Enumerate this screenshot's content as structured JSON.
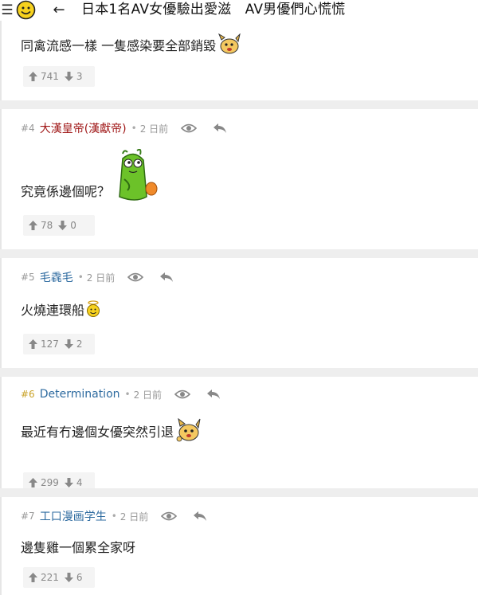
{
  "header": {
    "thread_title": "日本1名AV女優驗出愛滋　AV男優們心慌慌"
  },
  "posts": [
    {
      "content": "同禽流感一樣 一隻感染要全部銷毀",
      "emoji": "horned-dog-sticker",
      "upvotes": "741",
      "downvotes": "3"
    },
    {
      "floor": "#4",
      "author": "大漢皇帝(漢獻帝)",
      "time": "2 日前",
      "content": "究竟係邊個呢？",
      "emoji": "green-worm-sticker",
      "upvotes": "78",
      "downvotes": "0"
    },
    {
      "floor": "#5",
      "author": "毛毳毛",
      "time": "2 日前",
      "content": "火燒連環船",
      "emoji": "angel-smiley",
      "upvotes": "127",
      "downvotes": "2"
    },
    {
      "floor": "#6",
      "author": "Determination",
      "time": "2 日前",
      "content": "最近有冇邊個女優突然引退",
      "emoji": "dog-sticker",
      "upvotes": "299",
      "downvotes": "4"
    },
    {
      "floor": "#7",
      "author": "工口漫画学生",
      "time": "2 日前",
      "content": "邊隻雞一個累全家呀",
      "upvotes": "221",
      "downvotes": "6"
    }
  ],
  "colors": {
    "author_op": "#a01818",
    "author_normal": "#2e6ba0",
    "floor_highlight": "#c9a227",
    "separator": "#eeeeee",
    "vote_bg": "#f4f4f4"
  }
}
